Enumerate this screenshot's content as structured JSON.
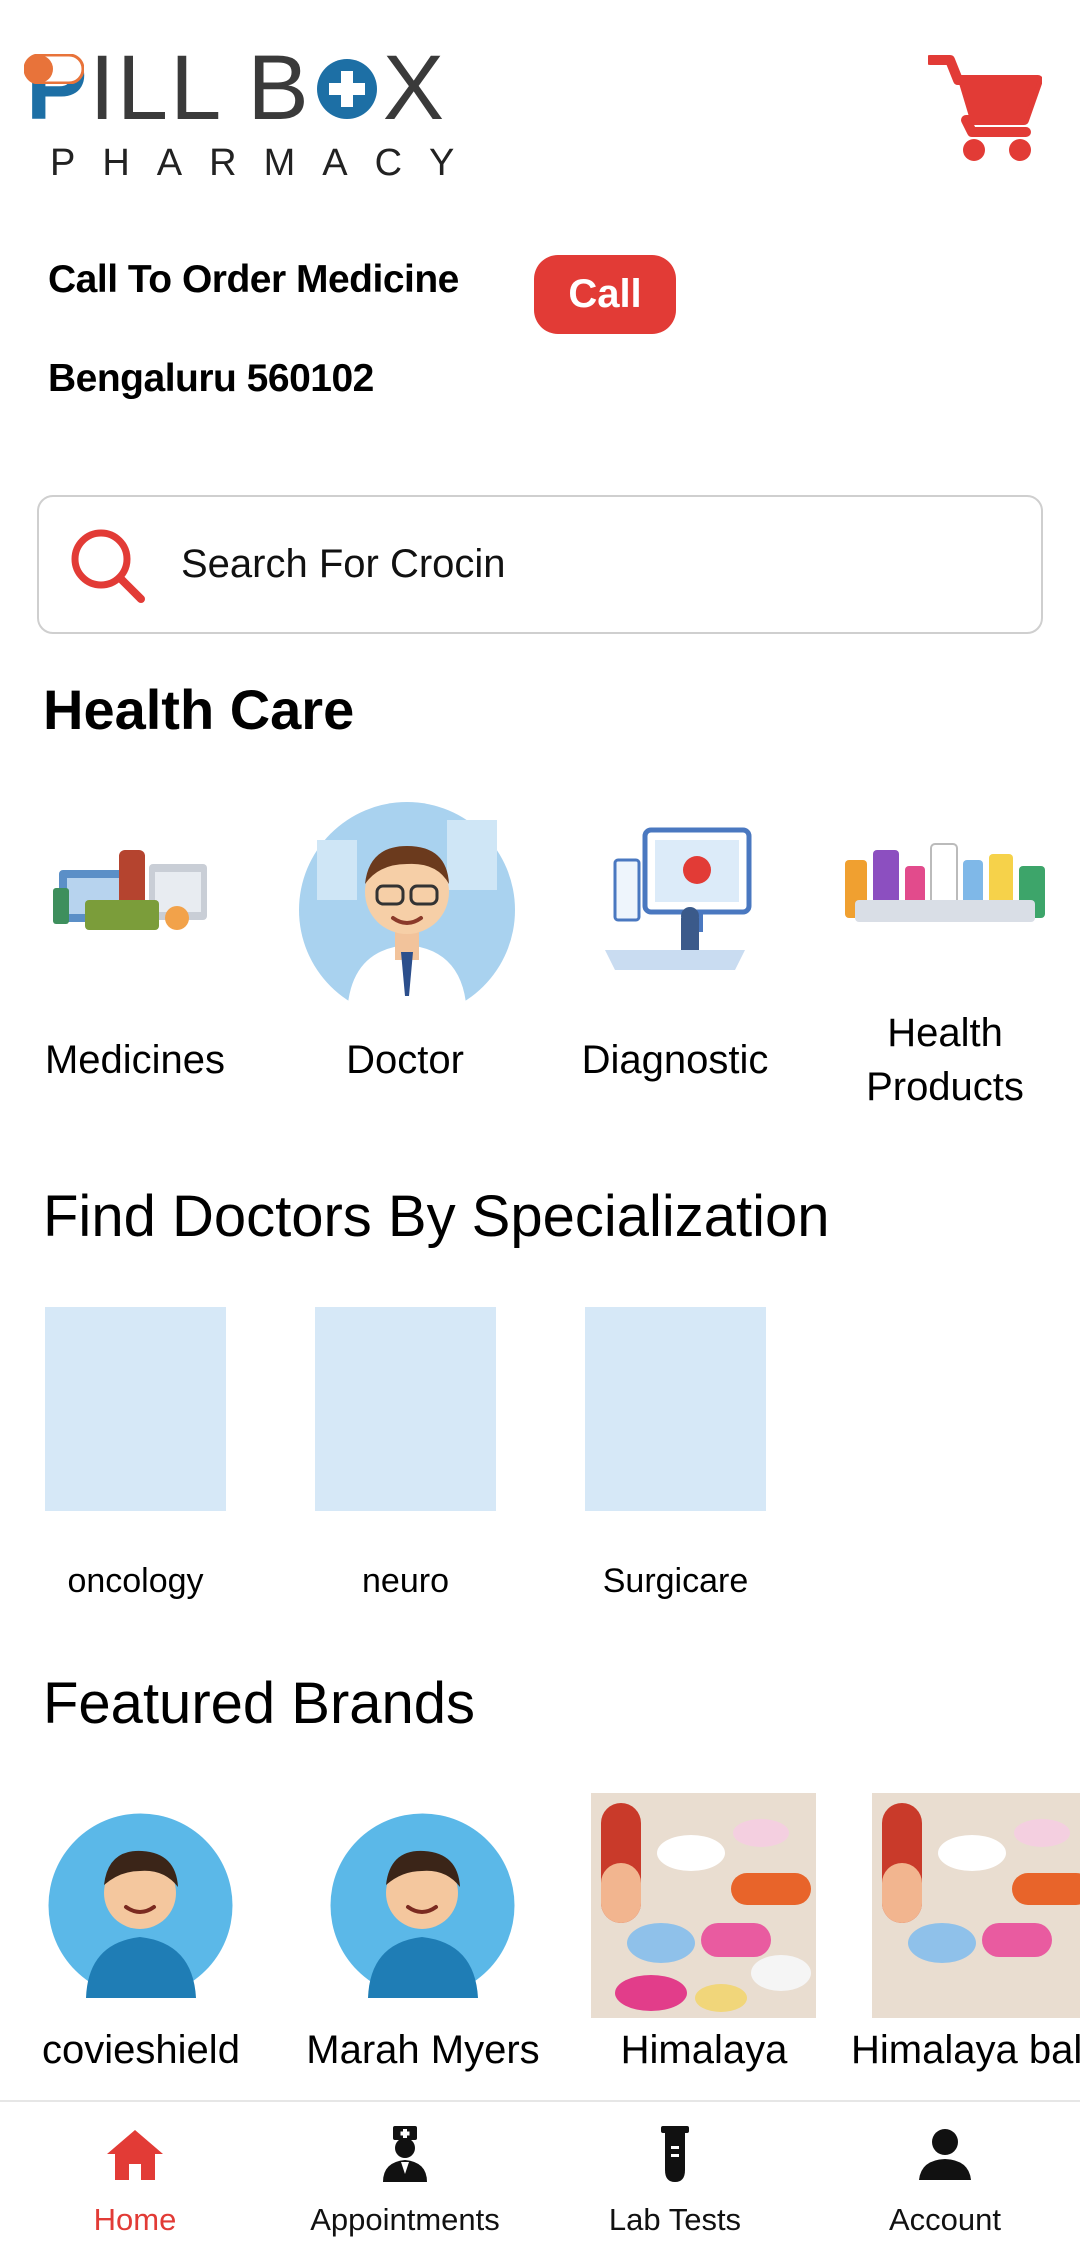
{
  "brand": {
    "logo_main_p": "P",
    "logo_main_rest_1": "ILL B",
    "logo_main_rest_2": "X",
    "logo_sub": "PHARMACY"
  },
  "header": {
    "cart_icon": "shopping-cart-icon"
  },
  "order": {
    "call_to_order": "Call To Order Medicine",
    "call_button": "Call",
    "location": "Bengaluru  560102"
  },
  "search": {
    "placeholder": "Search For Crocin",
    "icon": "search-icon"
  },
  "health_care": {
    "title": "Health Care",
    "items": [
      {
        "label": "Medicines"
      },
      {
        "label": "Doctor"
      },
      {
        "label": "Diagnostic"
      },
      {
        "label_line1": "Health",
        "label_line2": "Products"
      }
    ]
  },
  "specialization": {
    "title": "Find Doctors By Specialization",
    "items": [
      {
        "label": "oncology"
      },
      {
        "label": "neuro"
      },
      {
        "label": "Surgicare"
      }
    ]
  },
  "featured_brands": {
    "title": "Featured Brands",
    "items": [
      {
        "label": "covieshield"
      },
      {
        "label": "Marah Myers"
      },
      {
        "label": "Himalaya"
      },
      {
        "label": "Himalaya bal"
      }
    ]
  },
  "bottom_nav": {
    "items": [
      {
        "label": "Home",
        "icon": "home-icon",
        "active": true
      },
      {
        "label": "Appointments",
        "icon": "doctor-icon",
        "active": false
      },
      {
        "label": "Lab Tests",
        "icon": "test-tube-icon",
        "active": false
      },
      {
        "label": "Account",
        "icon": "person-icon",
        "active": false
      }
    ]
  },
  "colors": {
    "accent": "#e23b36",
    "brand_blue": "#1d6fa5",
    "spec_placeholder": "#d6e8f7"
  }
}
